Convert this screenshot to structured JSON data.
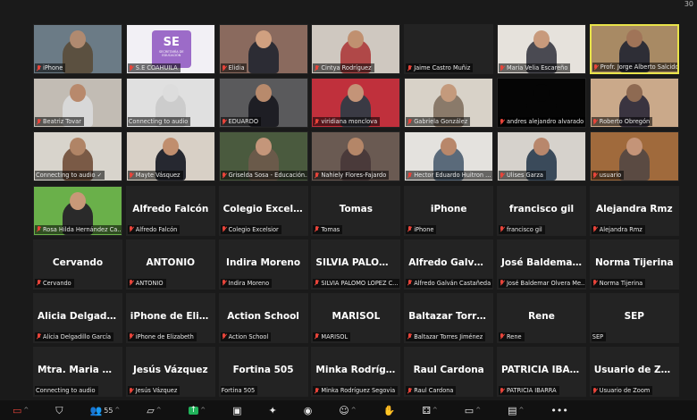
{
  "corner_text": "30",
  "tiles": [
    {
      "type": "video",
      "label": "iPhone",
      "bg": "#6b7b86",
      "skin": "#b08a70",
      "shirt": "#5b5040"
    },
    {
      "type": "video",
      "label": "S.E COAHUILA",
      "bg": "#f2f0f5",
      "logo": "SE",
      "logo_sub": "SECRETARÍA DE EDUCACIÓN",
      "logo_color": "#9c6bc8"
    },
    {
      "type": "video",
      "label": "Elidia",
      "bg": "#8a6a5e",
      "skin": "#d0a080",
      "shirt": "#2c2c34"
    },
    {
      "type": "video",
      "label": "Cintya Rodríguez",
      "bg": "#cfc8c0",
      "skin": "#c09070",
      "shirt": "#b04848"
    },
    {
      "type": "text",
      "label": "Jaime Castro Muñiz",
      "name": ""
    },
    {
      "type": "video",
      "label": "Maria Velia Escareño",
      "bg": "#e6e2dc",
      "skin": "#c89a7c",
      "shirt": "#4a4a52"
    },
    {
      "type": "video",
      "label": "Profr. Jorge Alberto Salcido",
      "bg": "#a88a64",
      "skin": "#a07458",
      "shirt": "#2e2e36",
      "active": true
    },
    {
      "type": "video",
      "label": "Beatriz Tovar",
      "bg": "#c2bcb4",
      "skin": "#b8896c",
      "shirt": "#d8d8d8"
    },
    {
      "type": "video",
      "label": "Connecting to audio",
      "bg": "#e0e0e0",
      "skin": "#dddddd",
      "shirt": "#cccccc",
      "nomic": true
    },
    {
      "type": "video",
      "label": "EDUARDO",
      "bg": "#5a5a5c",
      "skin": "#b88a6c",
      "shirt": "#1e1e24"
    },
    {
      "type": "video",
      "label": "viridiana monclova",
      "bg": "#c0303c",
      "skin": "#c49478",
      "shirt": "#3a3a44"
    },
    {
      "type": "video",
      "label": "Gabriela González",
      "bg": "#d8d2c8",
      "skin": "#c49a7c",
      "shirt": "#8a7a6a"
    },
    {
      "type": "video",
      "label": "andres alejandro alvarado",
      "bg": "#050505",
      "skin": "#050505",
      "shirt": "#050505"
    },
    {
      "type": "video",
      "label": "Roberto Obregón",
      "bg": "#caa98a",
      "skin": "#8e6a52",
      "shirt": "#3a3440"
    },
    {
      "type": "video",
      "label": "Connecting to audio ✓",
      "bg": "#d8d4cc",
      "skin": "#b08466",
      "shirt": "#7a5a46",
      "nomic": true
    },
    {
      "type": "video",
      "label": "Mayte Vásquez",
      "bg": "#d8d0c6",
      "skin": "#c08e6e",
      "shirt": "#262830"
    },
    {
      "type": "video",
      "label": "Griselda Sosa - Educación...",
      "bg": "#4a5a3e",
      "skin": "#c4967a",
      "shirt": "#6a5a4a"
    },
    {
      "type": "video",
      "label": "Nahiely Flores-Fajardo",
      "bg": "#6a5a52",
      "skin": "#b48668",
      "shirt": "#4a3a3a"
    },
    {
      "type": "video",
      "label": "Hector Eduardo Huitron ...",
      "bg": "#e4e2de",
      "skin": "#b8876a",
      "shirt": "#5a6a7a"
    },
    {
      "type": "video",
      "label": "Ulises Garza",
      "bg": "#d6d2cc",
      "skin": "#b8876c",
      "shirt": "#3a4a5a"
    },
    {
      "type": "video",
      "label": "usuario",
      "bg": "#a06a3c",
      "skin": "#c49478",
      "shirt": "#5a4a42"
    },
    {
      "type": "video",
      "label": "Rosa Hilda Hernández Ca...",
      "bg": "#6ab04a",
      "skin": "#c89878",
      "shirt": "#2a2a2a"
    },
    {
      "type": "text",
      "label": "Alfredo Falcón",
      "name": "Alfredo Falcón"
    },
    {
      "type": "text",
      "label": "Colegio Excelsior",
      "name": "Colegio Excelsior"
    },
    {
      "type": "text",
      "label": "Tomas",
      "name": "Tomas"
    },
    {
      "type": "text",
      "label": "iPhone",
      "name": "iPhone"
    },
    {
      "type": "text",
      "label": "francisco gil",
      "name": "francisco gil"
    },
    {
      "type": "text",
      "label": "Alejandra Rmz",
      "name": "Alejandra Rmz"
    },
    {
      "type": "text",
      "label": "Cervando",
      "name": "Cervando"
    },
    {
      "type": "text",
      "label": "ANTONIO",
      "name": "ANTONIO"
    },
    {
      "type": "text",
      "label": "Indira Moreno",
      "name": "Indira Moreno"
    },
    {
      "type": "text",
      "label": "SILVIA PALOMO LOPEZ C...",
      "name": "SILVIA PALOMO..."
    },
    {
      "type": "text",
      "label": "Alfredo Galván Castañeda",
      "name": "Alfredo Galván..."
    },
    {
      "type": "text",
      "label": "José Baldemar Olvera Me...",
      "name": "José Baldemar..."
    },
    {
      "type": "text",
      "label": "Norma Tijerina",
      "name": "Norma Tijerina"
    },
    {
      "type": "text",
      "label": "Alicia Delgadillo García",
      "name": "Alicia Delgadill..."
    },
    {
      "type": "text",
      "label": "iPhone de Elizabeth",
      "name": "iPhone de Eliza..."
    },
    {
      "type": "text",
      "label": "Action School",
      "name": "Action School"
    },
    {
      "type": "text",
      "label": "MARISOL",
      "name": "MARISOL"
    },
    {
      "type": "text",
      "label": "Baltazar Torres Jiménez",
      "name": "Baltazar Torres..."
    },
    {
      "type": "text",
      "label": "Rene",
      "name": "Rene"
    },
    {
      "type": "text",
      "label": "SEP",
      "name": "SEP",
      "nomic": true
    },
    {
      "type": "text",
      "label": "Connecting to audio",
      "name": "Mtra. Maria Zav...",
      "nomic": true
    },
    {
      "type": "text",
      "label": "Jesús Vázquez",
      "name": "Jesús Vázquez"
    },
    {
      "type": "text",
      "label": "Fortina 505",
      "name": "Fortina 505",
      "nomic": true
    },
    {
      "type": "text",
      "label": "Minka Rodríguez Segovia",
      "name": "Minka Rodrígue..."
    },
    {
      "type": "text",
      "label": "Raul Cardona",
      "name": "Raul Cardona"
    },
    {
      "type": "text",
      "label": "PATRICIA IBARRA",
      "name": "PATRICIA IBARRA"
    },
    {
      "type": "text",
      "label": "Usuario de Zoom",
      "name": "Usuario de Zoom"
    }
  ],
  "toolbar": {
    "participants_count": "55",
    "items": [
      {
        "icon": "video-off-icon",
        "glyph": "▭",
        "red": true,
        "caret": true
      },
      {
        "icon": "security-icon",
        "glyph": "⛉"
      },
      {
        "icon": "participants-icon",
        "glyph": "👥",
        "count": true,
        "caret": true
      },
      {
        "icon": "chat-icon",
        "glyph": "▱",
        "caret": true
      },
      {
        "icon": "share-screen-icon",
        "glyph": "↑",
        "green": true,
        "caret": true
      },
      {
        "icon": "summary-icon",
        "glyph": "▣"
      },
      {
        "icon": "ai-companion-icon",
        "glyph": "✦"
      },
      {
        "icon": "record-icon",
        "glyph": "◉"
      },
      {
        "icon": "reactions-icon",
        "glyph": "☺",
        "caret": true
      },
      {
        "icon": "raise-hand-icon",
        "glyph": "✋"
      },
      {
        "icon": "apps-icon",
        "glyph": "⚃",
        "caret": true
      },
      {
        "icon": "view-icon",
        "glyph": "▭",
        "caret": true
      },
      {
        "icon": "notes-icon",
        "glyph": "▤",
        "caret": true
      },
      {
        "icon": "more-icon",
        "glyph": "•••"
      }
    ]
  }
}
